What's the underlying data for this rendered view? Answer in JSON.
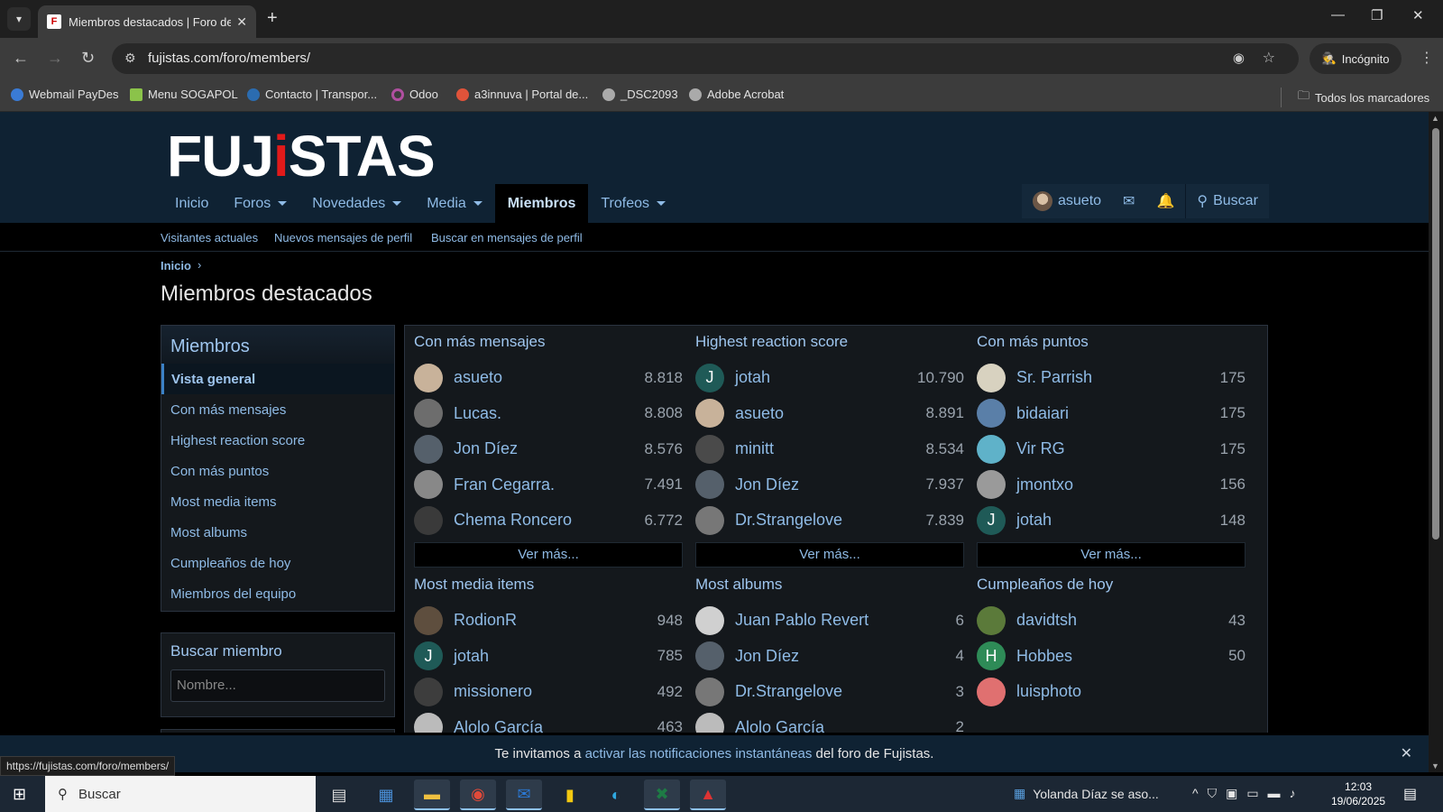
{
  "browser": {
    "tab_title": "Miembros destacados | Foro de Fujistas",
    "url": "fujistas.com/foro/members/",
    "incognito_label": "Incógnito",
    "bookmarks": [
      {
        "label": "Webmail PayDes",
        "color": "#3a7bd5"
      },
      {
        "label": "Menu SOGAPOL",
        "color": "#8bc34a"
      },
      {
        "label": "Contacto | Transpor...",
        "color": "#2b6cb0"
      },
      {
        "label": "Odoo",
        "color": "#b04fa0"
      },
      {
        "label": "a3innuva | Portal de...",
        "color": "#e0533a"
      },
      {
        "label": "_DSC2093",
        "color": "#aaaaaa"
      },
      {
        "label": "Adobe Acrobat",
        "color": "#aaaaaa"
      }
    ],
    "all_bookmarks_label": "Todos los marcadores",
    "status_url": "https://fujistas.com/foro/members/"
  },
  "site": {
    "logo_left": "FUJ",
    "logo_i": "i",
    "logo_right": "STAS",
    "nav": [
      {
        "label": "Inicio",
        "caret": false
      },
      {
        "label": "Foros",
        "caret": true
      },
      {
        "label": "Novedades",
        "caret": true
      },
      {
        "label": "Media",
        "caret": true
      },
      {
        "label": "Miembros",
        "caret": false,
        "active": true
      },
      {
        "label": "Trofeos",
        "caret": true
      }
    ],
    "user": "asueto",
    "search_label": "Buscar",
    "subnav": [
      "Visitantes actuales",
      "Nuevos mensajes de perfil",
      "Buscar en mensajes de perfil"
    ]
  },
  "breadcrumb": "Inicio",
  "page_title": "Miembros destacados",
  "sidebar": {
    "title": "Miembros",
    "items": [
      "Vista general",
      "Con más mensajes",
      "Highest reaction score",
      "Con más puntos",
      "Most media items",
      "Most albums",
      "Cumpleaños de hoy",
      "Miembros del equipo"
    ],
    "search_title": "Buscar miembro",
    "search_placeholder": "Nombre..."
  },
  "more_label": "Ver más...",
  "sections": [
    {
      "title": "Con más mensajes",
      "rows": [
        {
          "name": "asueto",
          "value": "8.818",
          "av": "#c8b29a"
        },
        {
          "name": "Lucas.",
          "value": "8.808",
          "av": "#6d6d6d"
        },
        {
          "name": "Jon Díez",
          "value": "8.576",
          "av": "#55606b"
        },
        {
          "name": "Fran Cegarra.",
          "value": "7.491",
          "av": "#888888"
        },
        {
          "name": "Chema Roncero",
          "value": "6.772",
          "av": "#3a3a3a"
        }
      ]
    },
    {
      "title": "Highest reaction score",
      "rows": [
        {
          "name": "jotah",
          "value": "10.790",
          "av": "#1f5a57",
          "letter": "J"
        },
        {
          "name": "asueto",
          "value": "8.891",
          "av": "#c8b29a"
        },
        {
          "name": "minitt",
          "value": "8.534",
          "av": "#4a4a4a"
        },
        {
          "name": "Jon Díez",
          "value": "7.937",
          "av": "#55606b"
        },
        {
          "name": "Dr.Strangelove",
          "value": "7.839",
          "av": "#777777"
        }
      ]
    },
    {
      "title": "Con más puntos",
      "rows": [
        {
          "name": "Sr. Parrish",
          "value": "175",
          "av": "#d8d2c0"
        },
        {
          "name": "bidaiari",
          "value": "175",
          "av": "#5a7fa8"
        },
        {
          "name": "Vir RG",
          "value": "175",
          "av": "#5fb2c9"
        },
        {
          "name": "jmontxo",
          "value": "156",
          "av": "#9a9a9a"
        },
        {
          "name": "jotah",
          "value": "148",
          "av": "#1f5a57",
          "letter": "J"
        }
      ]
    },
    {
      "title": "Most media items",
      "rows": [
        {
          "name": "RodionR",
          "value": "948",
          "av": "#5e4e3e"
        },
        {
          "name": "jotah",
          "value": "785",
          "av": "#1f5a57",
          "letter": "J"
        },
        {
          "name": "missionero",
          "value": "492",
          "av": "#3d3d3d"
        },
        {
          "name": "Alolo García",
          "value": "463",
          "av": "#bbbbbb"
        }
      ]
    },
    {
      "title": "Most albums",
      "rows": [
        {
          "name": "Juan Pablo Revert",
          "value": "6",
          "av": "#d0d0d0"
        },
        {
          "name": "Jon Díez",
          "value": "4",
          "av": "#55606b"
        },
        {
          "name": "Dr.Strangelove",
          "value": "3",
          "av": "#777777"
        },
        {
          "name": "Alolo García",
          "value": "2",
          "av": "#bbbbbb"
        }
      ]
    },
    {
      "title": "Cumpleaños de hoy",
      "rows": [
        {
          "name": "davidtsh",
          "value": "43",
          "av": "#5b7a3a"
        },
        {
          "name": "Hobbes",
          "value": "50",
          "av": "#2e8b57",
          "letter": "H"
        },
        {
          "name": "luisphoto",
          "value": "",
          "av": "#e07070"
        }
      ]
    }
  ],
  "notification": {
    "pre": "Te invitamos a ",
    "link": "activar las notificaciones instantáneas",
    "post": " del foro de Fujistas."
  },
  "taskbar": {
    "search": "Buscar",
    "news": "Yolanda Díaz se aso...",
    "time": "12:03",
    "date": "19/06/2025"
  }
}
